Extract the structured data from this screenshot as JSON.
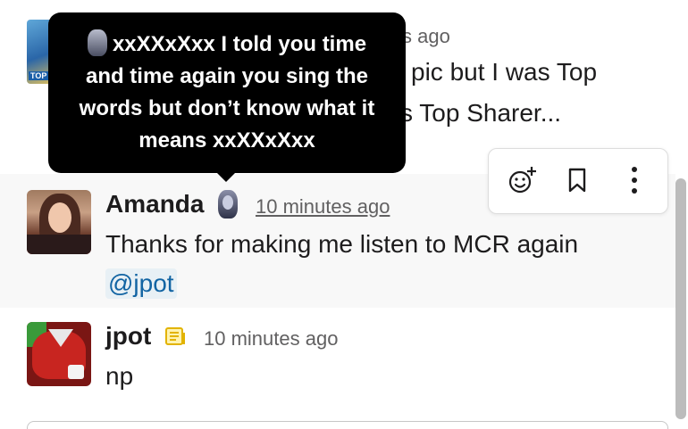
{
  "top_message": {
    "time": "s ago",
    "line1": "pic but I was Top",
    "line2": "s Top Sharer...",
    "avatar_label": "TOP"
  },
  "tooltip": {
    "text": "xxXXxXxx I told you time and time again you sing the words but don’t know what it means xxXXxXxx",
    "emoji": "vampire-status-icon"
  },
  "message_actions": {
    "icons": [
      "add-reaction-icon",
      "bookmark-icon",
      "more-actions-icon"
    ]
  },
  "amanda_message": {
    "name": "Amanda",
    "time": "10 minutes ago",
    "text": "Thanks for making me listen to MCR again",
    "mention": "@jpot"
  },
  "jpot_message": {
    "name": "jpot",
    "time": "10 minutes ago",
    "text": "np",
    "status_icon": "newspaper-icon"
  },
  "colors": {
    "text": "#1d1c1d",
    "muted": "#616061",
    "mention": "#1264a3",
    "mention_bg": "#e8f0f5",
    "hover_bg": "#f8f8f8",
    "tooltip_bg": "#000000",
    "news_icon": "#e2b300"
  }
}
